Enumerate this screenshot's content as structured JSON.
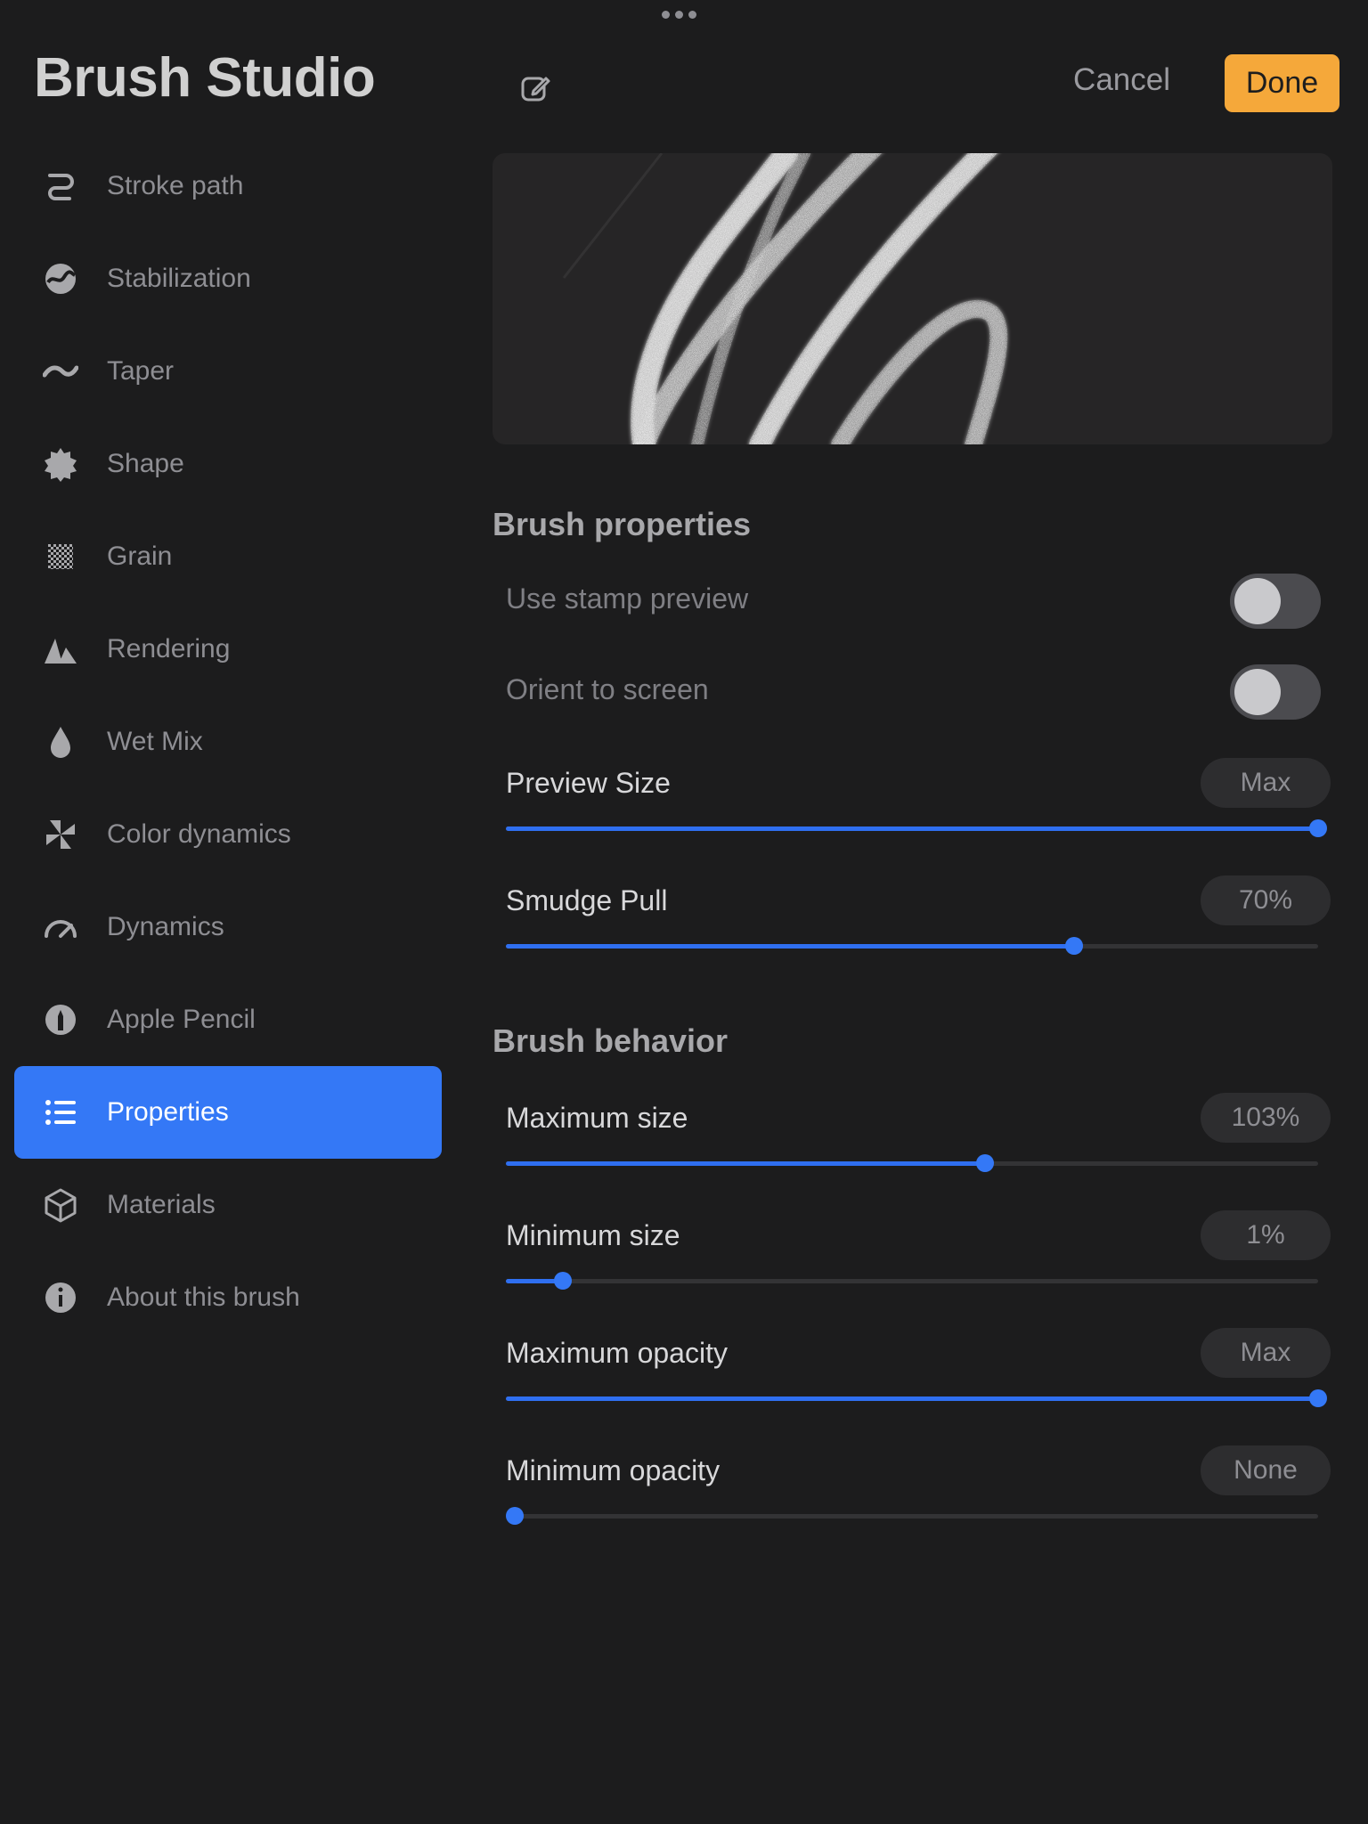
{
  "header": {
    "title": "Brush Studio",
    "cancel_label": "Cancel",
    "done_label": "Done",
    "accent_color": "#f5a83a"
  },
  "sidebar": {
    "items": [
      {
        "label": "Stroke path",
        "icon": "stroke-path-icon"
      },
      {
        "label": "Stabilization",
        "icon": "stabilization-icon"
      },
      {
        "label": "Taper",
        "icon": "taper-icon"
      },
      {
        "label": "Shape",
        "icon": "shape-icon"
      },
      {
        "label": "Grain",
        "icon": "grain-icon"
      },
      {
        "label": "Rendering",
        "icon": "rendering-icon"
      },
      {
        "label": "Wet Mix",
        "icon": "wet-mix-icon"
      },
      {
        "label": "Color dynamics",
        "icon": "color-dynamics-icon"
      },
      {
        "label": "Dynamics",
        "icon": "dynamics-icon"
      },
      {
        "label": "Apple Pencil",
        "icon": "apple-pencil-icon"
      },
      {
        "label": "Properties",
        "icon": "properties-icon",
        "active": true
      },
      {
        "label": "Materials",
        "icon": "materials-icon"
      },
      {
        "label": "About this brush",
        "icon": "info-icon"
      }
    ],
    "active_color": "#3478f6"
  },
  "brush_properties": {
    "title": "Brush properties",
    "toggles": [
      {
        "label": "Use stamp preview",
        "on": false
      },
      {
        "label": "Orient to screen",
        "on": false
      }
    ],
    "sliders": [
      {
        "label": "Preview Size",
        "value": "Max",
        "fraction": 1.0
      },
      {
        "label": "Smudge Pull",
        "value": "70%",
        "fraction": 0.7
      }
    ]
  },
  "brush_behavior": {
    "title": "Brush behavior",
    "sliders": [
      {
        "label": "Maximum size",
        "value": "103%",
        "fraction": 0.59
      },
      {
        "label": "Minimum size",
        "value": "1%",
        "fraction": 0.07
      },
      {
        "label": "Maximum opacity",
        "value": "Max",
        "fraction": 1.0
      },
      {
        "label": "Minimum opacity",
        "value": "None",
        "fraction": 0.0
      }
    ]
  }
}
